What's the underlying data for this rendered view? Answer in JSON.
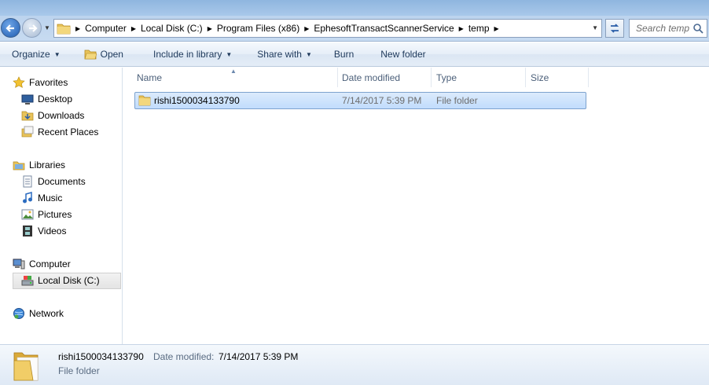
{
  "address": {
    "breadcrumbs": [
      "Computer",
      "Local Disk (C:)",
      "Program Files (x86)",
      "EphesoftTransactScannerService",
      "temp"
    ],
    "search_placeholder": "Search temp"
  },
  "toolbar": {
    "organize": "Organize",
    "open": "Open",
    "include_in_library": "Include in library",
    "share_with": "Share with",
    "burn": "Burn",
    "new_folder": "New folder"
  },
  "navpane": {
    "favorites": "Favorites",
    "desktop": "Desktop",
    "downloads": "Downloads",
    "recent_places": "Recent Places",
    "libraries": "Libraries",
    "documents": "Documents",
    "music": "Music",
    "pictures": "Pictures",
    "videos": "Videos",
    "computer": "Computer",
    "local_disk": "Local Disk (C:)",
    "network": "Network"
  },
  "columns": {
    "name": "Name",
    "date_modified": "Date modified",
    "type": "Type",
    "size": "Size"
  },
  "files": [
    {
      "name": "rishi1500034133790",
      "date_modified": "7/14/2017 5:39 PM",
      "type": "File folder",
      "size": ""
    }
  ],
  "details": {
    "name": "rishi1500034133790",
    "date_label": "Date modified:",
    "date_value": "7/14/2017 5:39 PM",
    "type": "File folder"
  },
  "colors": {
    "selection": "#c1dcfc",
    "selection_border": "#7da2ce",
    "toolbar_text": "#1e395b",
    "folder": "#e8c35a"
  }
}
